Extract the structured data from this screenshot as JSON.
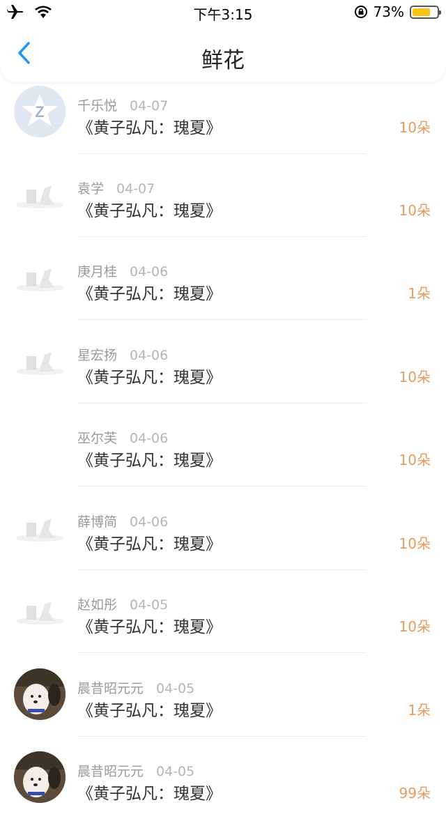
{
  "status_bar": {
    "time": "下午3:15",
    "battery_percent": "73%",
    "battery_level": 0.73,
    "icons": [
      "airplane-icon",
      "wifi-icon",
      "orientation-lock-icon",
      "battery-icon"
    ]
  },
  "nav": {
    "title": "鲜花",
    "back_icon": "chevron-left-icon",
    "accent_color": "#2196f3"
  },
  "colors": {
    "count": "#e89a5c",
    "name": "#9a9a9a"
  },
  "rows": [
    {
      "name": "千乐悦",
      "date": "04-07",
      "title": "《黄子弘凡：瑰夏》",
      "count": "10朵",
      "avatar": "qq-default"
    },
    {
      "name": "袁学",
      "date": "04-07",
      "title": "《黄子弘凡：瑰夏》",
      "count": "10朵",
      "avatar": "placeholder"
    },
    {
      "name": "庚月桂",
      "date": "04-06",
      "title": "《黄子弘凡：瑰夏》",
      "count": "1朵",
      "avatar": "placeholder"
    },
    {
      "name": "星宏扬",
      "date": "04-06",
      "title": "《黄子弘凡：瑰夏》",
      "count": "10朵",
      "avatar": "placeholder"
    },
    {
      "name": "巫尔芙",
      "date": "04-06",
      "title": "《黄子弘凡：瑰夏》",
      "count": "10朵",
      "avatar": "none"
    },
    {
      "name": "薛博简",
      "date": "04-06",
      "title": "《黄子弘凡：瑰夏》",
      "count": "10朵",
      "avatar": "placeholder"
    },
    {
      "name": "赵如彤",
      "date": "04-05",
      "title": "《黄子弘凡：瑰夏》",
      "count": "10朵",
      "avatar": "placeholder"
    },
    {
      "name": "晨昔昭元元",
      "date": "04-05",
      "title": "《黄子弘凡：瑰夏》",
      "count": "1朵",
      "avatar": "dog-photo"
    },
    {
      "name": "晨昔昭元元",
      "date": "04-05",
      "title": "《黄子弘凡：瑰夏》",
      "count": "99朵",
      "avatar": "dog-photo"
    }
  ]
}
